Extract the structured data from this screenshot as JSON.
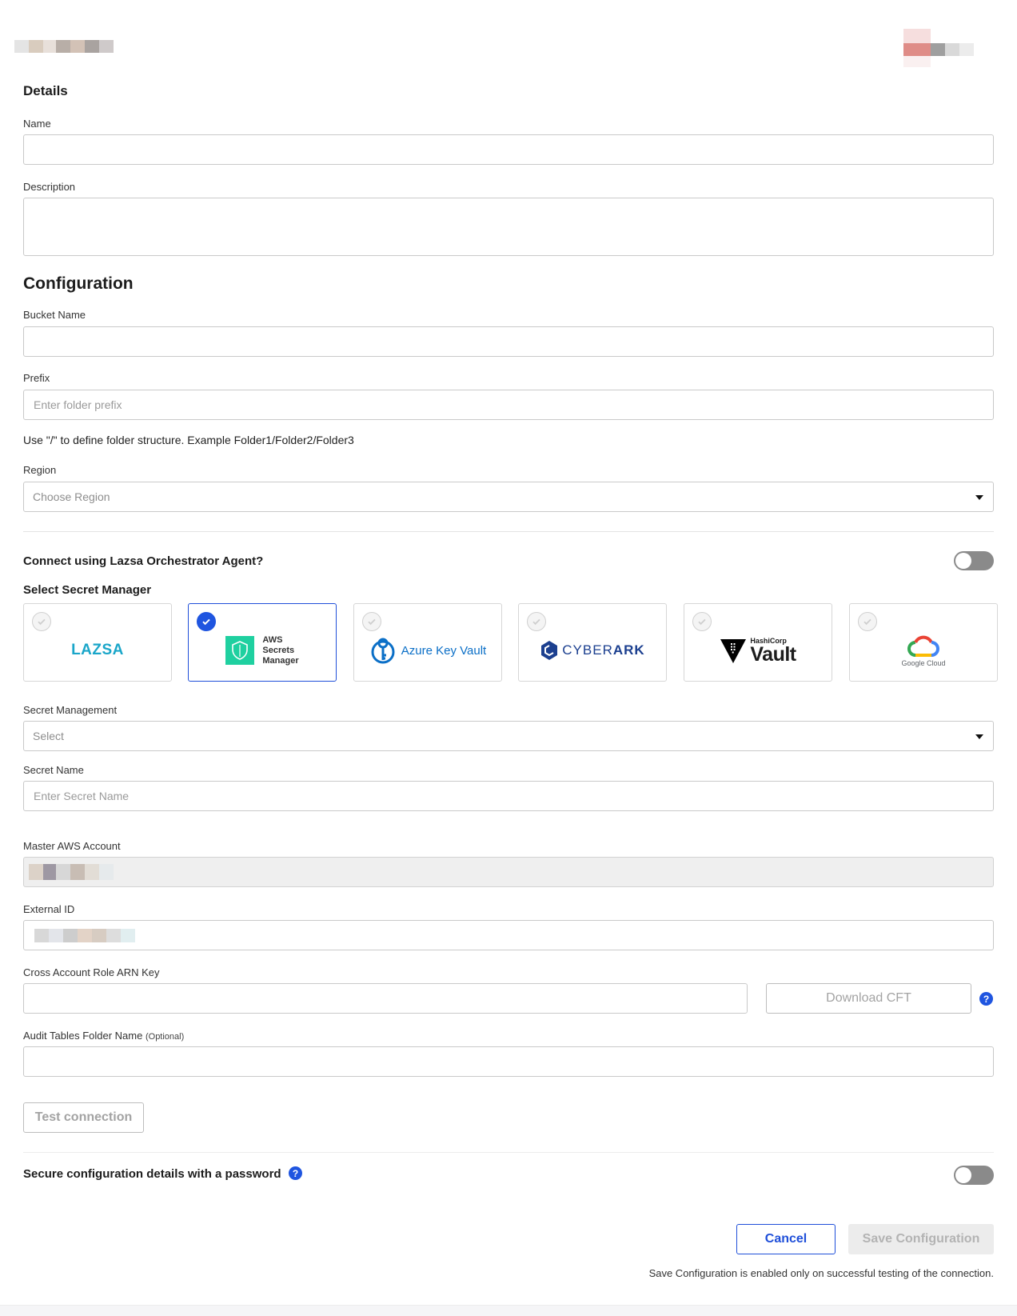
{
  "details": {
    "heading": "Details",
    "name_label": "Name",
    "name_value": "",
    "description_label": "Description",
    "description_value": ""
  },
  "configuration": {
    "heading": "Configuration",
    "bucket_label": "Bucket Name",
    "bucket_value": "",
    "prefix_label": "Prefix",
    "prefix_placeholder": "Enter folder prefix",
    "prefix_hint": "Use \"/\" to define folder structure. Example Folder1/Folder2/Folder3",
    "region_label": "Region",
    "region_placeholder": "Choose Region"
  },
  "agent": {
    "question": "Connect using Lazsa Orchestrator Agent?",
    "enabled": false
  },
  "secret_manager": {
    "label": "Select Secret Manager",
    "selected": "aws",
    "options": [
      {
        "id": "lazsa",
        "text": "LAZSA",
        "color": "#1aa6c9"
      },
      {
        "id": "aws",
        "lines": [
          "AWS",
          "Secrets",
          "Manager"
        ],
        "color": "#1fd0a0"
      },
      {
        "id": "azure",
        "text": "Azure Key Vault",
        "color": "#0b6fc7"
      },
      {
        "id": "cyberark",
        "text_a": "CYBER",
        "text_b": "ARK",
        "color": "#1b3f8f"
      },
      {
        "id": "hashicorp",
        "small": "HashiCorp",
        "big": "Vault",
        "color": "#000000"
      },
      {
        "id": "gcp",
        "text": "Google Cloud",
        "color": "#5f6368"
      }
    ]
  },
  "secret": {
    "management_label": "Secret Management",
    "management_placeholder": "Select",
    "name_label": "Secret Name",
    "name_placeholder": "Enter Secret Name"
  },
  "aws": {
    "master_label": "Master AWS Account",
    "external_id_label": "External ID",
    "role_arn_label": "Cross Account Role ARN Key",
    "role_arn_value": "",
    "download_cft": "Download CFT",
    "help_glyph": "?",
    "audit_label": "Audit Tables Folder Name",
    "audit_optional": "(Optional)",
    "audit_value": ""
  },
  "test_connection": "Test connection",
  "secure": {
    "label": "Secure configuration details with a password",
    "help_glyph": "?",
    "enabled": false
  },
  "actions": {
    "cancel": "Cancel",
    "save": "Save Configuration",
    "note": "Save Configuration is enabled only on successful testing of the connection."
  },
  "colors": {
    "accent": "#1f55e0",
    "border": "#c9c9c9",
    "toggle_off": "#8a8a8a",
    "disabled_text": "#a3a3a3"
  }
}
